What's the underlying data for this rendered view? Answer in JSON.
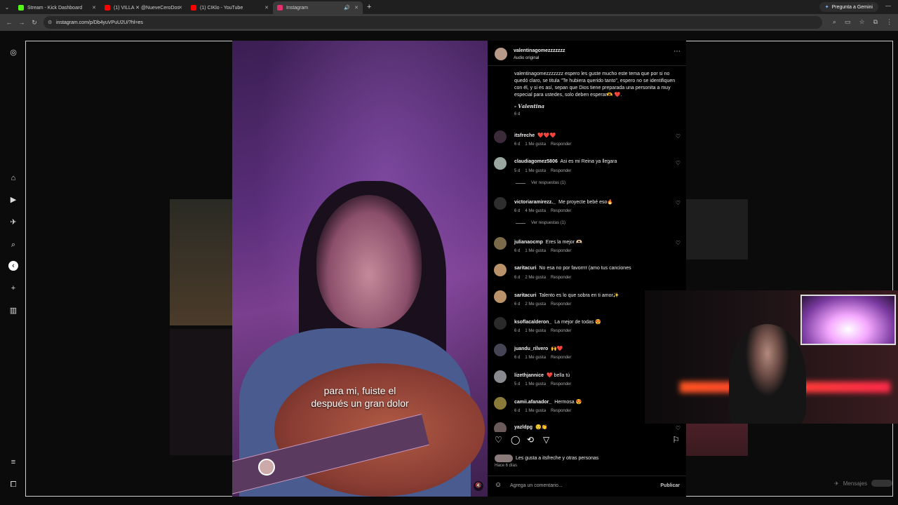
{
  "browser": {
    "tabs": [
      {
        "label": "Stream - Kick Dashboard",
        "color": "#53fc18"
      },
      {
        "label": "(1) VILLA ✕ @NueveCeroDos",
        "color": "#ff0000"
      },
      {
        "label": "(1) CIKlo - YouTube",
        "color": "#ff0000"
      },
      {
        "label": "Instagram",
        "color": "#e1306c",
        "active": true
      }
    ],
    "gemini_label": "Pregunta a Gemini",
    "url": "instagram.com/p/Db4yuVPuU2U/?hl=es"
  },
  "post": {
    "username": "valentinagomezzzzzzz",
    "audio": "Audio original",
    "caption": "valentinagomezzzzzzz espero les guste mucho este tema que por si no quedó claro, se titula \"Te hubiera querido tanto\", espero no se identifiquen con él, y si es así, sepan que Dios tiene preparada una personita a muy especial para ustedes, solo deben esperar🫶 ❤️.",
    "signature": "- 𝑽𝒂𝒍𝒆𝒏𝒕𝒊𝒏𝒂",
    "caption_date": "6 d",
    "subtitle_line1": "para mi, fuiste el",
    "subtitle_line2": "después un gran dolor",
    "likes_text": "Les gusta a itsfreche y otras personas",
    "posted_ago": "Hace 6 días",
    "comment_placeholder": "Agrega un comentario...",
    "publish_label": "Publicar"
  },
  "comments": [
    {
      "user": "itsfreche",
      "text": "❤️❤️❤️",
      "age": "6 d",
      "likes": "1 Me gusta",
      "reply": "Responder",
      "avatar_color": "#3b2a3a"
    },
    {
      "user": "claudiagomez5806",
      "text": "Asi es mi Reina ya llegara",
      "age": "5 d",
      "likes": "1 Me gusta",
      "reply": "Responder",
      "avatar_color": "#9aa7a0",
      "view_replies": "Ver respuestas (1)"
    },
    {
      "user": "victoriaramirezz._",
      "text": "Me proyecte bebé eso🔥",
      "age": "6 d",
      "likes": "4 Me gusta",
      "reply": "Responder",
      "avatar_color": "#2e2e2e",
      "view_replies": "Ver respuestas (1)"
    },
    {
      "user": "julianaocmp",
      "text": "Eres la mejor 🫶🏻",
      "age": "6 d",
      "likes": "1 Me gusta",
      "reply": "Responder",
      "avatar_color": "#7a6a4a"
    },
    {
      "user": "saritacuri",
      "text": "No esa no por favorrrr (amo tus canciones",
      "age": "6 d",
      "likes": "2 Me gusta",
      "reply": "Responder",
      "avatar_color": "#b9926a"
    },
    {
      "user": "saritacuri",
      "text": "Talento es lo que sobra en ti amor✨",
      "age": "6 d",
      "likes": "2 Me gusta",
      "reply": "Responder",
      "avatar_color": "#b9926a"
    },
    {
      "user": "ksoflacalderon_",
      "text": "La mejor de todas 😍",
      "age": "6 d",
      "likes": "1 Me gusta",
      "reply": "Responder",
      "avatar_color": "#2a2a2a"
    },
    {
      "user": "juandu_rilvero",
      "text": "🙌❤️",
      "age": "6 d",
      "likes": "1 Me gusta",
      "reply": "Responder",
      "avatar_color": "#444455"
    },
    {
      "user": "lizethjannice",
      "text": "❤️ bella tú",
      "age": "5 d",
      "likes": "1 Me gusta",
      "reply": "Responder",
      "avatar_color": "#888a90"
    },
    {
      "user": "camii.afanador_",
      "text": "Hermosa 😍",
      "age": "6 d",
      "likes": "1 Me gusta",
      "reply": "Responder",
      "avatar_color": "#8a7a3a"
    },
    {
      "user": "yazldpg",
      "text": "😌👏",
      "age": "",
      "likes": "",
      "reply": "",
      "avatar_color": "#6a5a5a"
    }
  ],
  "stream_overlay": {
    "mensajes_label": "Mensajes"
  }
}
